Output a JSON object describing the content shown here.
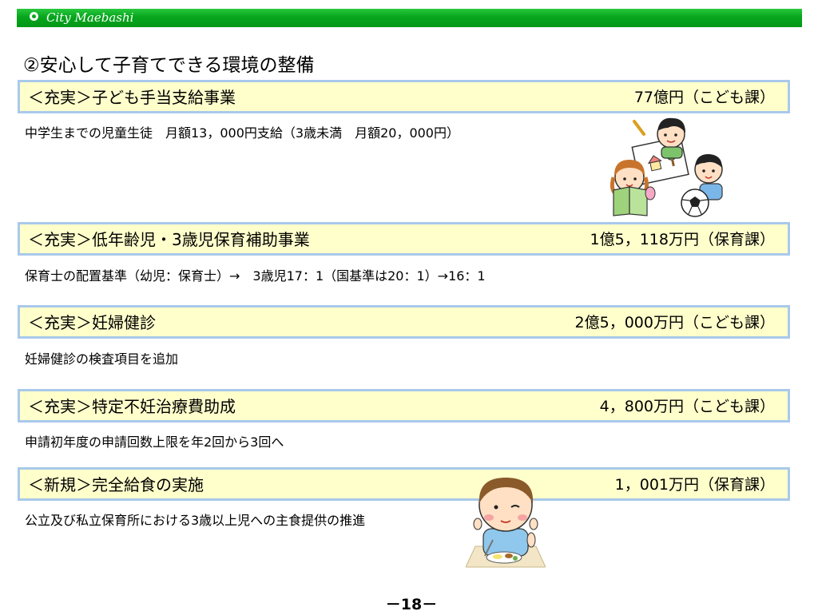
{
  "header": {
    "title": "City Maebashi"
  },
  "section": {
    "title": "②安心して子育てできる環境の整備"
  },
  "items": [
    {
      "title": "＜充実＞子ども手当支給事業",
      "amount": "77億円（こども課）",
      "description": "中学生までの児童生徒　月額13，000円支給（3歳未満　月額20，000円）"
    },
    {
      "title": "＜充実＞低年齢児・3歳児保育補助事業",
      "amount": "1億5，118万円（保育課）",
      "description": "保育士の配置基準（幼児：保育士）→　3歳児17：1（国基準は20：1）→16：1"
    },
    {
      "title": "＜充実＞妊婦健診",
      "amount": "2億5，000万円（こども課）",
      "description": "妊婦健診の検査項目を追加"
    },
    {
      "title": "＜充実＞特定不妊治療費助成",
      "amount": "4，800万円（こども課）",
      "description": "申請初年度の申請回数上限を年2回から3回へ"
    },
    {
      "title": "＜新規＞完全給食の実施",
      "amount": "1，001万円（保育課）",
      "description": "公立及び私立保育所における3歳以上児への主食提供の推進"
    }
  ],
  "footer": {
    "page_number": "－18－"
  },
  "colors": {
    "header_green": "#07a51d",
    "box_fill": "#ffffcc",
    "box_border": "#a9c9eb"
  },
  "icons": {
    "children": "children-reading-drawing-soccer-illustration",
    "meal": "child-eating-meal-illustration"
  }
}
